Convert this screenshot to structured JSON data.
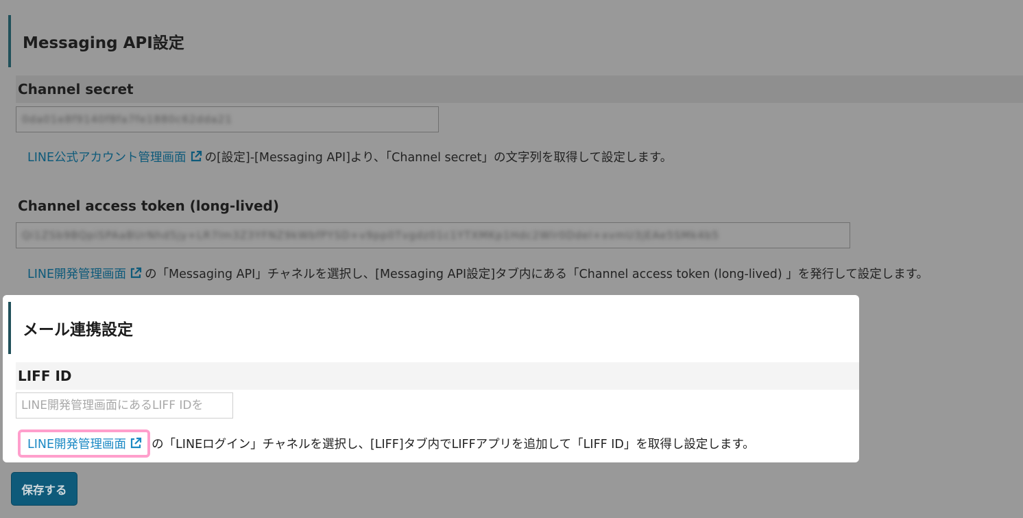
{
  "messaging": {
    "title": "Messaging API設定",
    "channel_secret": {
      "label": "Channel secret",
      "value": "0da01e8f9140f8fa7fe1880c62dda21",
      "help_link": "LINE公式アカウント管理画面",
      "help_text": "の[設定]-[Messaging API]より、「Channel secret」の文字列を取得して設定します。"
    },
    "access_token": {
      "label": "Channel access token (long-lived)",
      "value": "Qi1ZSb9BQpiSPAaBUrNhd5jy+LR7lm3Z3YFNZ9kWbfPYSD+v9pp0Tvgdz01c1YTXMKp1Hdc2Wlr0Ddel+xvmU3jEAe5SMk4b5",
      "help_link": "LINE開発管理画面",
      "help_text": "の「Messaging API」チャネルを選択し、[Messaging API設定]タブ内にある「Channel access token (long-lived) 」を発行して設定します。"
    }
  },
  "mail": {
    "title": "メール連携設定",
    "liff": {
      "label": "LIFF ID",
      "placeholder": "LINE開発管理画面にあるLIFF IDを",
      "help_link": "LINE開発管理画面",
      "help_text": "の「LINEログイン」チャネルを選択し、[LIFF]タブ内でLIFFアプリを追加して「LIFF ID」を取得し設定します。"
    }
  },
  "save_button": "保存する",
  "colors": {
    "overlay": "#999999",
    "accent": "#20505a",
    "link": "#1b89c4",
    "highlight": "#ff9fcc",
    "button": "#0e5a7a"
  },
  "icons": [
    "external-link-icon"
  ]
}
